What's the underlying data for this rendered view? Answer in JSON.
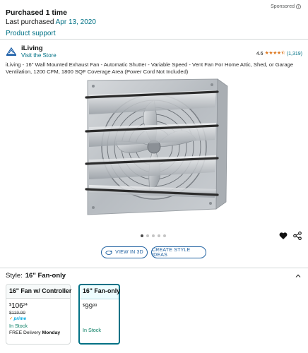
{
  "sponsored": {
    "label": "Sponsored",
    "info_icon": "info-icon"
  },
  "purchase": {
    "title": "Purchased 1 time",
    "last_prefix": "Last purchased",
    "last_date": "Apr 13, 2020",
    "support_link": "Product support"
  },
  "brand": {
    "name": "iLiving",
    "visit_link": "Visit the Store",
    "rating": "4.6",
    "stars": "★★★★⯪",
    "review_count": "(1,319)"
  },
  "product": {
    "title": "iLiving - 16\" Wall Mounted Exhaust Fan - Automatic Shutter - Variable Speed - Vent Fan For Home Attic, Shed, or Garage Ventilation, 1200 CFM, 1800 SQF Coverage Area (Power Cord Not Included)"
  },
  "gallery": {
    "dot_count": 5,
    "active_index": 0
  },
  "actions": {
    "view_3d_label": "VIEW IN 3D",
    "style_ideas_label": "CREATE STYLE IDEAS"
  },
  "style": {
    "label": "Style:",
    "selected": "16\" Fan-only"
  },
  "options": [
    {
      "name": "16\" Fan w/ Controller",
      "price_symbol": "$",
      "price_whole": "106",
      "price_fraction": "24",
      "list_price": "$119.99",
      "prime": "prime",
      "availability": "In Stock",
      "delivery_prefix": "FREE Delivery",
      "delivery_day": "Monday"
    },
    {
      "name": "16\" Fan-only",
      "price_symbol": "$",
      "price_whole": "99",
      "price_fraction": "99",
      "availability": "In Stock"
    }
  ],
  "colors": {
    "link": "#007185",
    "button": "#2162a1",
    "stock": "#067d62",
    "star": "#de7921",
    "selected_border": "#007185"
  }
}
